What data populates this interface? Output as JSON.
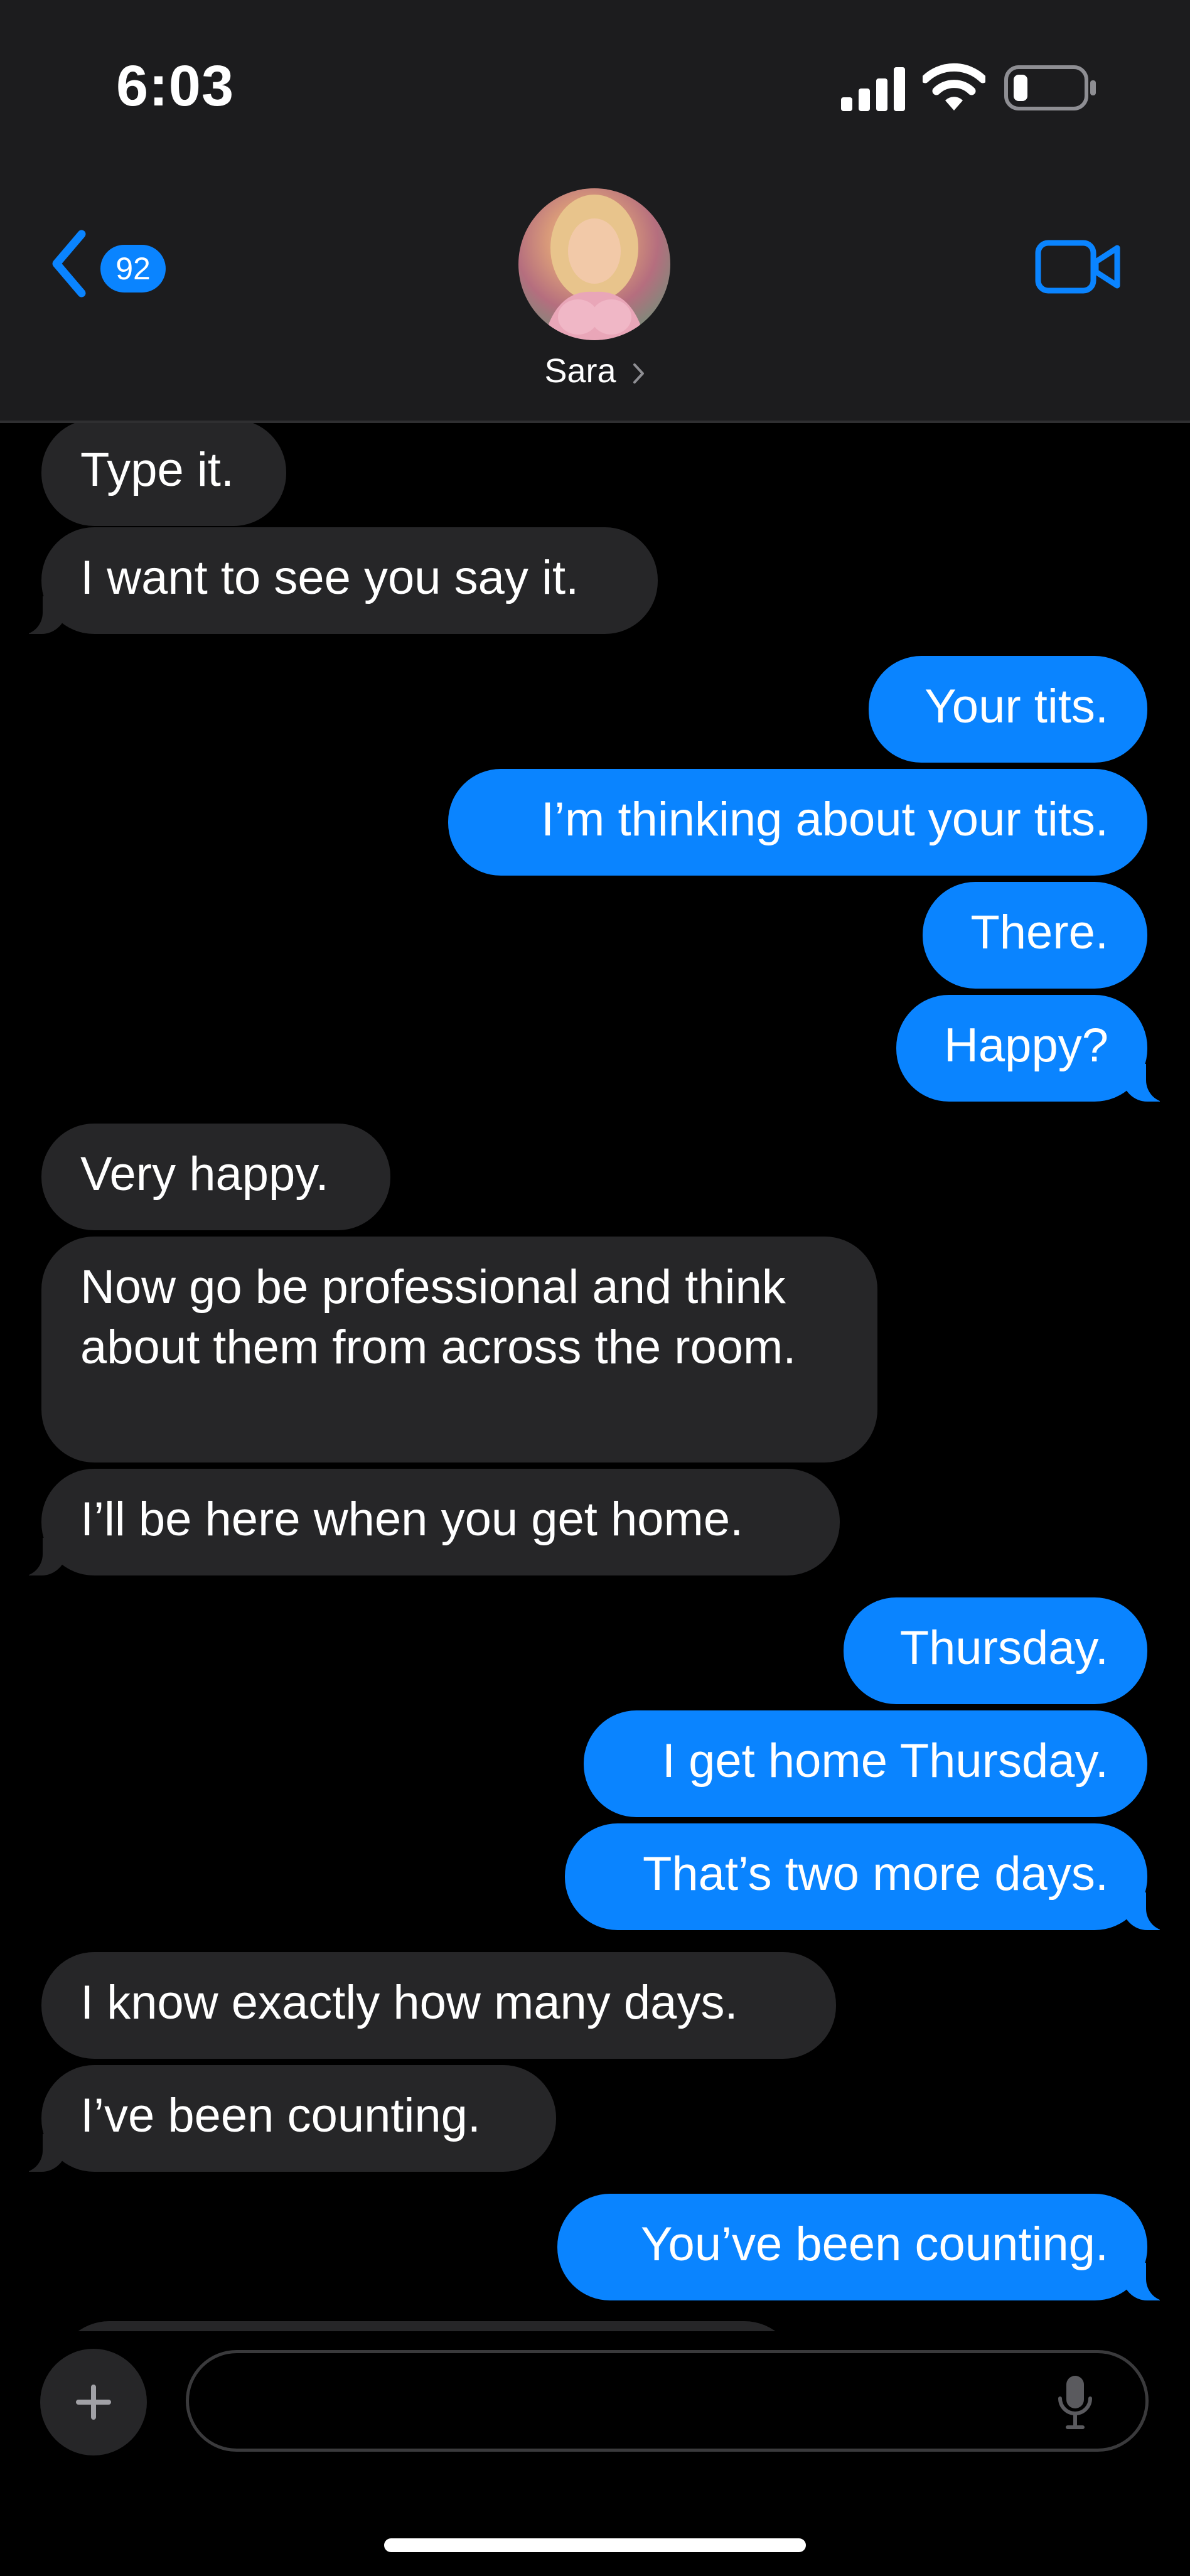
{
  "status_bar": {
    "time": "6:03",
    "signal_icon": "cellular-signal-icon",
    "wifi_icon": "wifi-icon",
    "battery_icon": "battery-low-icon"
  },
  "header": {
    "unread_count": "92",
    "contact_name": "Sara",
    "back_icon": "chevron-left-icon",
    "video_icon": "video-camera-icon",
    "disclosure_icon": "chevron-right-icon"
  },
  "messages": [
    {
      "from": "them",
      "text": "Type it."
    },
    {
      "from": "them",
      "text": "I want to see you say it."
    },
    {
      "from": "me",
      "text": "Your tits."
    },
    {
      "from": "me",
      "text": "I’m thinking about your tits."
    },
    {
      "from": "me",
      "text": "There."
    },
    {
      "from": "me",
      "text": "Happy?"
    },
    {
      "from": "them",
      "text": "Very happy."
    },
    {
      "from": "them",
      "text": "Now go be professional and think about them from across the room."
    },
    {
      "from": "them",
      "text": "I’ll be here when you get home."
    },
    {
      "from": "me",
      "text": "Thursday."
    },
    {
      "from": "me",
      "text": "I get home Thursday."
    },
    {
      "from": "me",
      "text": "That’s two more days."
    },
    {
      "from": "them",
      "text": "I know exactly how many days."
    },
    {
      "from": "them",
      "text": "I’ve been counting."
    },
    {
      "from": "me",
      "text": "You’ve been counting."
    }
  ],
  "composer": {
    "placeholder": "",
    "plus_icon": "plus-icon",
    "mic_icon": "microphone-icon"
  },
  "colors": {
    "outgoing_bubble": "#0a84ff",
    "incoming_bubble": "#262628",
    "accent": "#0a84ff",
    "background": "#000000",
    "header_background": "#1c1c1e"
  }
}
